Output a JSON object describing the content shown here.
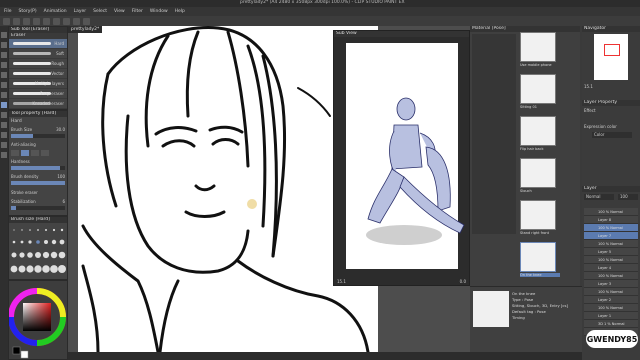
{
  "app": {
    "title": "prettylady2* (A4 2480 x 3508px 300dpi 100.0%) - CLIP STUDIO PAINT EX",
    "menu": [
      "File",
      "Story(P)",
      "Animation",
      "Layer",
      "Select",
      "View",
      "Filter",
      "Window",
      "Help"
    ],
    "document_tab": "prettylady2*"
  },
  "left_panel": {
    "subtool_header": "Sub Tool [Eraser]",
    "tool_tab": "Eraser",
    "brushes": [
      "Hard",
      "Soft",
      "Rough",
      "Vector",
      "Multiple layers",
      "Snap eraser",
      "Kneaded eraser"
    ],
    "tool_property_header": "Tool property [Hard]",
    "tool_property_name": "Hard",
    "brush_size_label": "Brush Size",
    "brush_size_value": "30.0",
    "anti_aliasing_label": "Anti-aliasing",
    "hardness_label": "Hardness",
    "brush_density_label": "Brush density",
    "brush_density_value": "100",
    "stroke_eraser_label": "Stroke eraser",
    "stabilization_label": "Stabilization",
    "stabilization_value": "6",
    "brush_size_panel_header": "Brush size [Hard]",
    "brush_size_presets": [
      "5",
      "6",
      "7",
      "8",
      "10",
      "12",
      "15",
      "17",
      "20",
      "25",
      "30",
      "40",
      "50",
      "60",
      "70",
      "80",
      "100",
      "120",
      "150",
      "170",
      "200",
      "250",
      "300",
      "400",
      "500",
      "600",
      "700",
      "800"
    ]
  },
  "sub_view": {
    "header": "Sub View",
    "zoom": "15.1",
    "angle": "0.0"
  },
  "material": {
    "header": "Material [Pose]",
    "items": [
      "Use mobile phone",
      "Sitting 01",
      "Flip hair back",
      "Slouch",
      "Stand right front",
      "On the knee"
    ],
    "detail": {
      "name": "On the knee",
      "type": "Type : Pose",
      "layer": "Default tag : Pose",
      "tags": "Sitting, Slouch, 3D, Entry [cs]",
      "timing": "Timing"
    }
  },
  "navigator": {
    "header": "Navigator",
    "zoom": "15.1"
  },
  "layer_property": {
    "header": "Layer Property",
    "effect_label": "Effect",
    "expression_color_label": "Expression color",
    "expression_color_value": "Color"
  },
  "layers": {
    "header": "Layer",
    "blend_mode": "Normal",
    "opacity": "100",
    "rows": [
      {
        "name": "100 % Normal",
        "sub": "Layer 8"
      },
      {
        "name": "100 % Normal",
        "sub": "Layer 7",
        "selected": true
      },
      {
        "name": "100 % Normal",
        "sub": "Layer 5"
      },
      {
        "name": "100 % Normal",
        "sub": "Layer 4"
      },
      {
        "name": "100 % Normal",
        "sub": "Layer 3"
      },
      {
        "name": "100 % Normal",
        "sub": "Layer 2"
      },
      {
        "name": "100 % Normal",
        "sub": "Layer 1"
      },
      {
        "name": "3D 1 % Normal",
        "sub": "sitting figure"
      }
    ]
  },
  "watermark": "GWENDY85"
}
